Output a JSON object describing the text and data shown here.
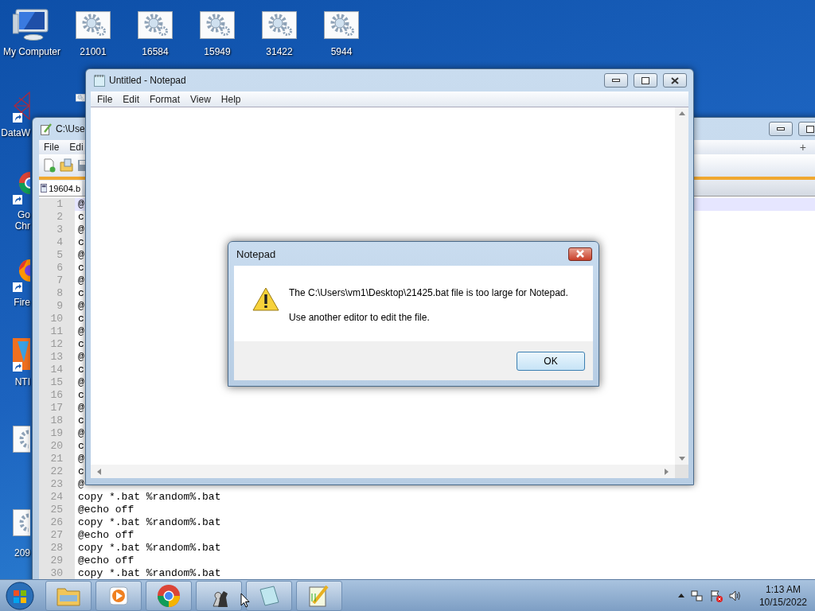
{
  "desktop_icons": [
    {
      "label": "My Computer",
      "kind": "computer"
    },
    {
      "label": "21001",
      "kind": "batch"
    },
    {
      "label": "16584",
      "kind": "batch"
    },
    {
      "label": "15949",
      "kind": "batch"
    },
    {
      "label": "31422",
      "kind": "batch"
    },
    {
      "label": "5944",
      "kind": "batch"
    }
  ],
  "side_icons": [
    {
      "kind": "network",
      "shortcut": true,
      "lines": [
        "DataW"
      ]
    },
    {
      "kind": "browser",
      "shortcut": true,
      "lines": [
        "Go",
        "Chr"
      ]
    },
    {
      "kind": "fox",
      "shortcut": true,
      "lines": [
        "Fire"
      ]
    },
    {
      "kind": "orange",
      "shortcut": true,
      "lines": [
        "NTI"
      ]
    },
    {
      "kind": "batch",
      "shortcut": false
    },
    {
      "kind": "batch",
      "shortcut": false,
      "lines": [
        "209"
      ]
    }
  ],
  "editor_window": {
    "title": "C:\\Use",
    "menu": [
      "File",
      "Edi"
    ],
    "tab": "19604.b",
    "lines": [
      {
        "number": "1",
        "text": "@",
        "current": true
      },
      {
        "number": "2",
        "text": "c",
        "current": false
      },
      {
        "number": "3",
        "text": "@",
        "current": false
      },
      {
        "number": "4",
        "text": "c",
        "current": false
      },
      {
        "number": "5",
        "text": "@",
        "current": false
      },
      {
        "number": "6",
        "text": "c",
        "current": false
      },
      {
        "number": "7",
        "text": "@",
        "current": false
      },
      {
        "number": "8",
        "text": "c",
        "current": false
      },
      {
        "number": "9",
        "text": "@",
        "current": false
      },
      {
        "number": "10",
        "text": "c",
        "current": false
      },
      {
        "number": "11",
        "text": "@",
        "current": false
      },
      {
        "number": "12",
        "text": "c",
        "current": false
      },
      {
        "number": "13",
        "text": "@",
        "current": false
      },
      {
        "number": "14",
        "text": "c",
        "current": false
      },
      {
        "number": "15",
        "text": "@",
        "current": false
      },
      {
        "number": "16",
        "text": "c",
        "current": false
      },
      {
        "number": "17",
        "text": "@",
        "current": false
      },
      {
        "number": "18",
        "text": "c",
        "current": false
      },
      {
        "number": "19",
        "text": "@",
        "current": false
      },
      {
        "number": "20",
        "text": "c",
        "current": false
      },
      {
        "number": "21",
        "text": "@",
        "current": false
      },
      {
        "number": "22",
        "text": "c",
        "current": false
      },
      {
        "number": "23",
        "text": "@",
        "current": false
      },
      {
        "number": "24",
        "text": "copy *.bat %random%.bat",
        "current": false
      },
      {
        "number": "25",
        "text": "@echo off",
        "current": false
      },
      {
        "number": "26",
        "text": "copy *.bat %random%.bat",
        "current": false
      },
      {
        "number": "27",
        "text": "@echo off",
        "current": false
      },
      {
        "number": "28",
        "text": "copy *.bat %random%.bat",
        "current": false
      },
      {
        "number": "29",
        "text": "@echo off",
        "current": false
      },
      {
        "number": "30",
        "text": "copy *.bat %random%.bat",
        "current": false
      }
    ],
    "toolbar_plus": "+"
  },
  "notepad_window": {
    "title": "Untitled - Notepad",
    "menu": [
      "File",
      "Edit",
      "Format",
      "View",
      "Help"
    ]
  },
  "dialog": {
    "title": "Notepad",
    "message": "The C:\\Users\\vm1\\Desktop\\21425.bat file is too large for Notepad.",
    "hint": "Use another editor to edit the file.",
    "button": "OK"
  },
  "taskbar": {
    "buttons": [
      {
        "kind": "folder"
      },
      {
        "kind": "media"
      },
      {
        "kind": "browser"
      },
      {
        "kind": "chess"
      },
      {
        "kind": "notepad"
      },
      {
        "kind": "editor"
      }
    ],
    "time": "1:13 AM",
    "date": "10/15/2022"
  }
}
